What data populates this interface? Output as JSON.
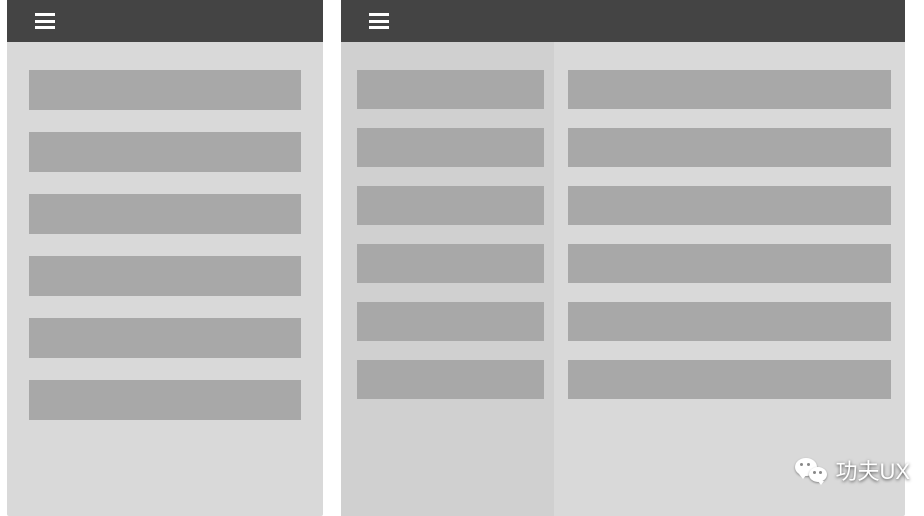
{
  "leftPanel": {
    "items": [
      {
        "label": ""
      },
      {
        "label": ""
      },
      {
        "label": ""
      },
      {
        "label": ""
      },
      {
        "label": ""
      },
      {
        "label": ""
      }
    ]
  },
  "rightPanel": {
    "sidebar": {
      "items": [
        {
          "label": ""
        },
        {
          "label": ""
        },
        {
          "label": ""
        },
        {
          "label": ""
        },
        {
          "label": ""
        },
        {
          "label": ""
        }
      ]
    },
    "main": {
      "items": [
        {
          "label": ""
        },
        {
          "label": ""
        },
        {
          "label": ""
        },
        {
          "label": ""
        },
        {
          "label": ""
        },
        {
          "label": ""
        }
      ]
    }
  },
  "watermark": {
    "text": "功夫UX"
  }
}
